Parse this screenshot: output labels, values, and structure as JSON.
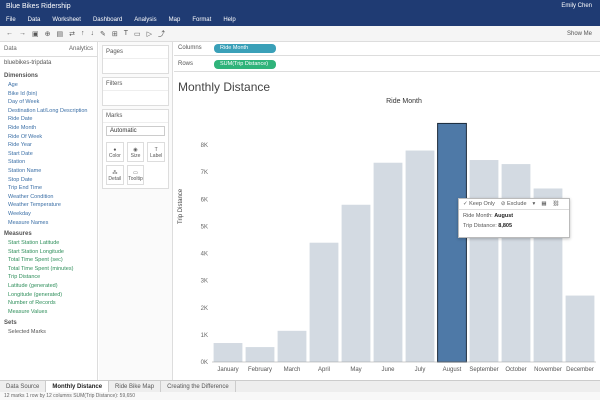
{
  "app": {
    "title": "Blue Bikes Ridership",
    "user": "Emily Chen"
  },
  "menu": [
    "File",
    "Data",
    "Worksheet",
    "Dashboard",
    "Analysis",
    "Map",
    "Format",
    "Help"
  ],
  "toolbar": {
    "show_me": "Show Me"
  },
  "data_pane": {
    "tab_data": "Data",
    "tab_analytics": "Analytics",
    "datasource": "bluebikes-tripdata",
    "dimensions_label": "Dimensions",
    "dimensions": [
      "Age",
      "Bike Id (bin)",
      "Day of Week",
      "Destination Lat/Long Description",
      "Ride Date",
      "Ride Month",
      "Ride Of Week",
      "Ride Year",
      "Start Date",
      "Station",
      "Station Name",
      "Stop Date",
      "Trip End Time",
      "Weather Condition",
      "Weather Temperature",
      "Weekday",
      "Measure Names"
    ],
    "measures_label": "Measures",
    "measures": [
      "Start Station Latitude",
      "Start Station Longitude",
      "Total Time Spent (sec)",
      "Total Time Spent (minutes)",
      "Trip Distance",
      "Latitude (generated)",
      "Longitude (generated)",
      "Number of Records",
      "Measure Values"
    ],
    "sets_label": "Sets",
    "sets": [
      "Selected Marks"
    ]
  },
  "shelves": {
    "pages": "Pages",
    "filters": "Filters",
    "marks": "Marks",
    "mark_type": "Automatic",
    "mark_buttons": [
      "Color",
      "Size",
      "Label",
      "Detail",
      "Tooltip"
    ],
    "columns_label": "Columns",
    "columns_pill": "Ride Month",
    "rows_label": "Rows",
    "rows_pill": "SUM(Trip Distance)"
  },
  "viz": {
    "title": "Monthly Distance"
  },
  "chart_data": {
    "type": "bar",
    "title": "Ride Month",
    "ylabel": "Trip Distance",
    "xlabel": "",
    "categories": [
      "January",
      "February",
      "March",
      "April",
      "May",
      "June",
      "July",
      "August",
      "September",
      "October",
      "November",
      "December"
    ],
    "values": [
      700,
      550,
      1150,
      4400,
      5800,
      7350,
      7800,
      8800,
      7450,
      7300,
      6400,
      2450
    ],
    "ylim": [
      0,
      9000
    ],
    "yticks": [
      0,
      1000,
      2000,
      3000,
      4000,
      5000,
      6000,
      7000,
      8000
    ],
    "ytick_labels": [
      "0K",
      "1K",
      "2K",
      "3K",
      "4K",
      "5K",
      "6K",
      "7K",
      "8K"
    ],
    "bar_color": "#d3dae2",
    "highlight_color": "#4e79a7",
    "highlight_index": 7,
    "grid": false
  },
  "tooltip": {
    "keep_only": "Keep Only",
    "exclude": "Exclude",
    "line1_label": "Ride Month:",
    "line1_value": "August",
    "line2_label": "Trip Distance:",
    "line2_value": "8,805"
  },
  "sheet_tabs": [
    "Data Source",
    "Monthly Distance",
    "Ride Bike Map",
    "Creating the Difference"
  ],
  "active_tab": 1,
  "status": "12 marks   1 row by 12 columns   SUM(Trip Distance): 59,650"
}
